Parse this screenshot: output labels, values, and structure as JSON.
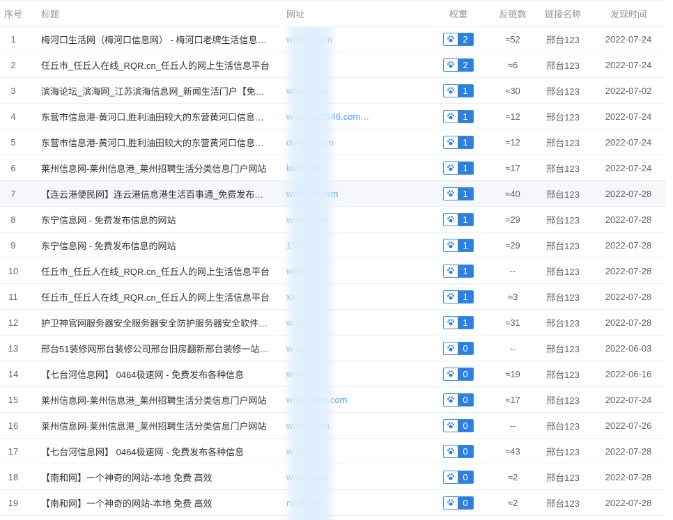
{
  "header": {
    "no": "序号",
    "title": "标题",
    "url": "网址",
    "weight": "权重",
    "backlinks": "反链数",
    "link_name": "链接名称",
    "found_time": "发现时间"
  },
  "rows": [
    {
      "no": "1",
      "title": "梅河口生活网（梅河口信息网） - 梅河口老牌生活信息网站",
      "url": "www.i        .com",
      "weight": "2",
      "backlinks": "≈52",
      "link_name": "邢台123",
      "date": "2022-07-24"
    },
    {
      "no": "2",
      "title": "任丘市_任丘人在线_RQR.cn_任丘人的网上生活信息平台",
      "url": "",
      "weight": "2",
      "backlinks": "≈6",
      "link_name": "邢台123",
      "date": "2022-07-24"
    },
    {
      "no": "3",
      "title": "滨海论坛_滨海网_江苏滨海信息网_新闻生活门户【免费发…",
      "url": "www.           g.cn",
      "weight": "1",
      "backlinks": "≈30",
      "link_name": "邢台123",
      "date": "2022-07-02"
    },
    {
      "no": "4",
      "title": "东营市信息港-黄河口,胜利油田较大的东营黄河口信息门户…",
      "url": "www.            ng0546.com…",
      "weight": "1",
      "backlinks": "≈12",
      "link_name": "邢台123",
      "date": "2022-07-24"
    },
    {
      "no": "5",
      "title": "东营市信息港-黄河口,胜利油田较大的东营黄河口信息门户…",
      "url": "dong            6.com",
      "weight": "1",
      "backlinks": "≈12",
      "link_name": "邢台123",
      "date": "2022-07-24"
    },
    {
      "no": "6",
      "title": "莱州信息网-莱州信息港_莱州招聘生活分类信息门户网站",
      "url": "laizho          m",
      "weight": "1",
      "backlinks": "≈17",
      "link_name": "邢台123",
      "date": "2022-07-24"
    },
    {
      "no": "7",
      "title": "【连云港便民网】连云港信息港生活百事通_免费发布连云…",
      "url": "www.l           w.com",
      "weight": "1",
      "backlinks": "≈40",
      "link_name": "邢台123",
      "date": "2022-07-28"
    },
    {
      "no": "8",
      "title": "东宁信息网 - 免费发布信息的网站",
      "url": "www.           0.cn",
      "weight": "1",
      "backlinks": "≈29",
      "link_name": "邢台123",
      "date": "2022-07-28"
    },
    {
      "no": "9",
      "title": "东宁信息网 - 免费发布信息的网站",
      "url": "1572",
      "weight": "1",
      "backlinks": "≈29",
      "link_name": "邢台123",
      "date": "2022-07-28"
    },
    {
      "no": "10",
      "title": "任丘市_任丘人在线_RQR.cn_任丘人的网上生活信息平台",
      "url": "www",
      "weight": "1",
      "backlinks": "--",
      "link_name": "邢台123",
      "date": "2022-07-28"
    },
    {
      "no": "11",
      "title": "任丘市_任丘人在线_RQR.cn_任丘人的网上生活信息平台",
      "url": "xx.r",
      "weight": "1",
      "backlinks": "≈3",
      "link_name": "邢台123",
      "date": "2022-07-28"
    },
    {
      "no": "12",
      "title": "护卫神官网服务器安全服务器安全防护服务器安全软件服…",
      "url": "w            om",
      "weight": "1",
      "backlinks": "≈31",
      "link_name": "邢台123",
      "date": "2022-07-28"
    },
    {
      "no": "13",
      "title": "邢台51装修网邢台装修公司邢台旧房翻新邢台装修一站式…",
      "url": "w             ng.cn",
      "weight": "0",
      "backlinks": "--",
      "link_name": "邢台123",
      "date": "2022-06-03"
    },
    {
      "no": "14",
      "title": "【七台河信息网】 0464极速网 - 免费发布各种信息",
      "url": "w            om",
      "weight": "0",
      "backlinks": "≈19",
      "link_name": "邢台123",
      "date": "2022-06-16"
    },
    {
      "no": "15",
      "title": "莱州信息网-莱州信息港_莱州招聘生活分类信息门户网站",
      "url": "www            ouxx.com",
      "weight": "0",
      "backlinks": "≈17",
      "link_name": "邢台123",
      "date": "2022-07-24"
    },
    {
      "no": "16",
      "title": "莱州信息网-莱州信息港_莱州招聘生活分类信息门户网站",
      "url": "wap           x.com",
      "weight": "0",
      "backlinks": "--",
      "link_name": "邢台123",
      "date": "2022-07-26"
    },
    {
      "no": "17",
      "title": "【七台河信息网】 0464极速网 - 免费发布各种信息",
      "url": "w             om",
      "weight": "0",
      "backlinks": "≈43",
      "link_name": "邢台123",
      "date": "2022-07-28"
    },
    {
      "no": "18",
      "title": "【南和网】一个神奇的网站-本地 免费 高效",
      "url": "www            .com",
      "weight": "0",
      "backlinks": "≈2",
      "link_name": "邢台123",
      "date": "2022-07-28"
    },
    {
      "no": "19",
      "title": "【南和网】一个神奇的网站-本地 免费 高效",
      "url": "nanh          om",
      "weight": "0",
      "backlinks": "≈2",
      "link_name": "邢台123",
      "date": "2022-07-28"
    }
  ],
  "highlighted_row": "7",
  "colors": {
    "link": "#409eff",
    "badge": "#2d7fe0",
    "header_text": "#909399"
  },
  "icons": {
    "weight_badge": "paw-icon"
  }
}
